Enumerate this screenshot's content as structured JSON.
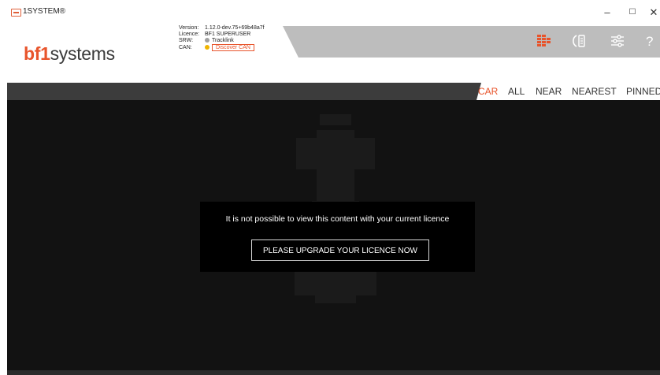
{
  "window": {
    "title": "1SYSTEM®",
    "minimize": "–",
    "maximize": "☐",
    "close": "✕"
  },
  "header": {
    "logo_prefix": "bf1",
    "logo_suffix": "systems",
    "info": {
      "version_label": "Version:",
      "version": "1.12.0-dev.75+69b48a7f",
      "licence_label": "Licence:",
      "licence": "BF1 SUPERUSER",
      "srw_label": "SRW:",
      "srw": "Tracklink",
      "srw_status_color": "#a0a0a0",
      "can_label": "CAN:",
      "can_button": "Discover CAN",
      "can_status_color": "#f0b400"
    },
    "icons": [
      "grid-layout-icon",
      "bluetooth-devices-icon",
      "settings-sliders-icon",
      "help-icon"
    ],
    "accent_color": "#e8542b"
  },
  "tabs": [
    {
      "label": "CAR",
      "active": true
    },
    {
      "label": "ALL",
      "active": false
    },
    {
      "label": "NEAR",
      "active": false
    },
    {
      "label": "NEAREST",
      "active": false
    },
    {
      "label": "PINNED",
      "active": false
    }
  ],
  "modal": {
    "message": "It is not possible to view this content with your current licence",
    "button": "PLEASE UPGRADE YOUR LICENCE NOW"
  }
}
